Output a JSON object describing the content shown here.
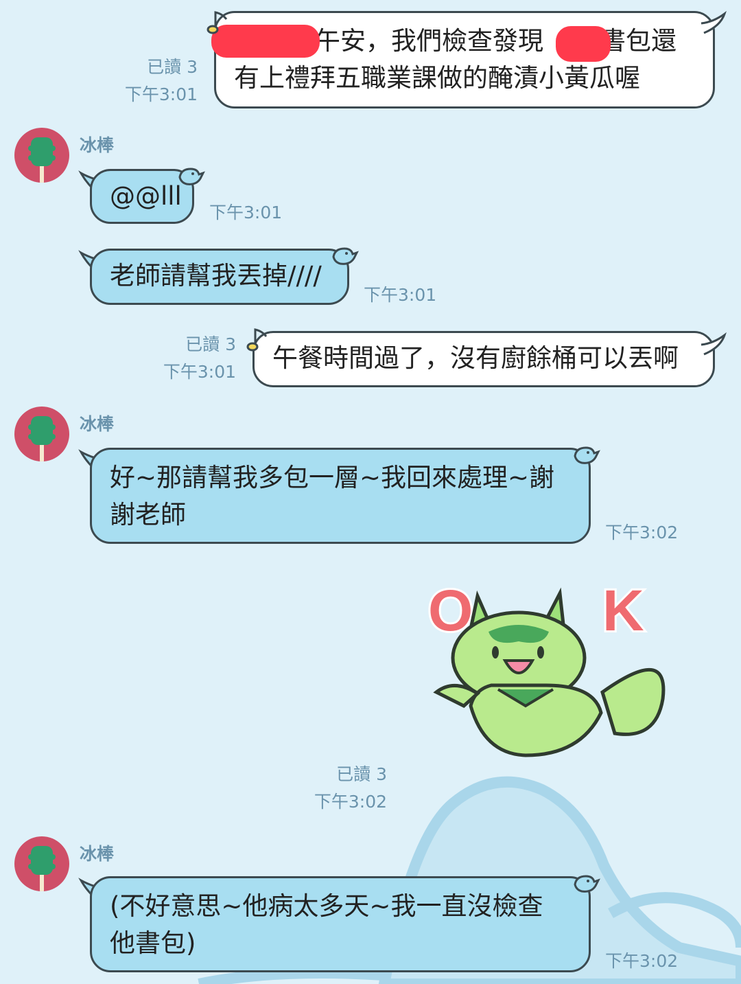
{
  "messages": [
    {
      "type": "outgoing",
      "read": "已讀 3",
      "time": "下午3:01",
      "lines": [
        "午安，我們檢查發現",
        "書包還",
        "有上禮拜五職業課做的醃漬小黃瓜喔"
      ]
    },
    {
      "type": "incoming",
      "sender": "冰棒",
      "text": "@@lll",
      "time": "下午3:01"
    },
    {
      "type": "incoming",
      "text": "老師請幫我丟掉////",
      "time": "下午3:01"
    },
    {
      "type": "outgoing",
      "read": "已讀 3",
      "time": "下午3:01",
      "text": "午餐時間過了，沒有廚餘桶可以丟啊"
    },
    {
      "type": "incoming",
      "sender": "冰棒",
      "lines": [
        "好~那請幫我多包一層~我回來處理~謝",
        "謝老師"
      ],
      "time": "下午3:02"
    },
    {
      "type": "sticker",
      "sticker_text": "OK",
      "read": "已讀 3",
      "time": "下午3:02"
    },
    {
      "type": "incoming",
      "sender": "冰棒",
      "lines": [
        "(不好意思~他病太多天~我一直沒檢查",
        "他書包)"
      ],
      "time": "下午3:02"
    }
  ],
  "colors": {
    "background": "#dff1f9",
    "incoming_bubble": "#a8def1",
    "outgoing_bubble": "#ffffff",
    "meta_text": "#6a93ac",
    "avatar": "#cf4f68",
    "sticker_green": "#9ee07a",
    "sticker_text": "#ef6b70"
  },
  "icons": [
    "music-note-icon",
    "bird-icon",
    "avatar-popsicle-icon"
  ]
}
